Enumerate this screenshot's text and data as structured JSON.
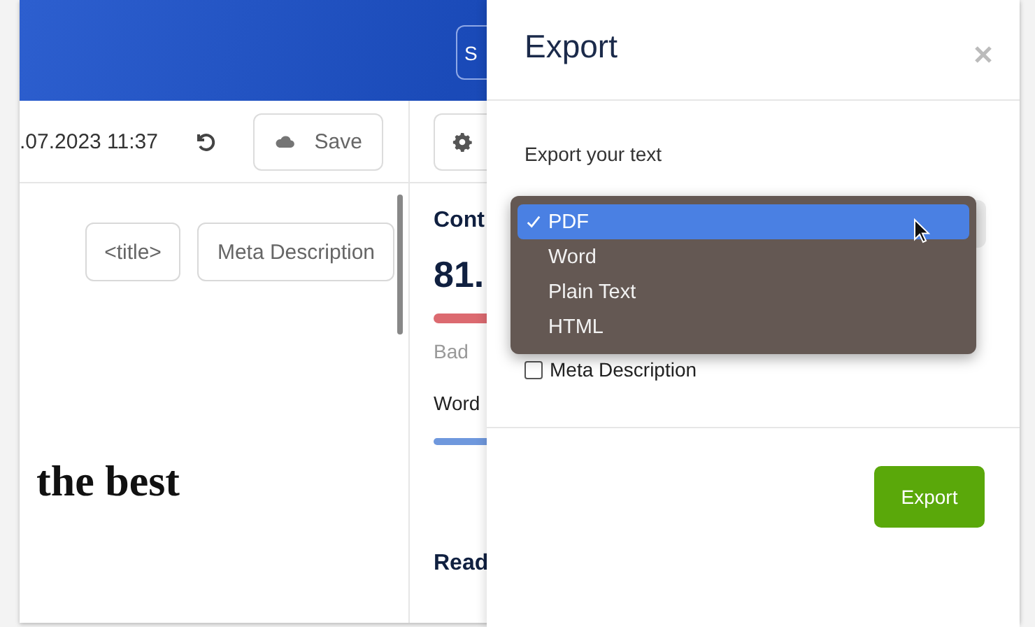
{
  "header": {
    "button_label": "S"
  },
  "toolbar": {
    "timestamp": ".07.2023 11:37",
    "save_label": "Save"
  },
  "editor": {
    "tag_buttons": [
      "<title>",
      "Meta Description"
    ],
    "heading": "the best"
  },
  "score_panel": {
    "title": "Cont",
    "score": "81.",
    "rating": "Bad",
    "words_label": "Word",
    "section": "Read"
  },
  "export_dialog": {
    "title": "Export",
    "prompt": "Export your text",
    "format_options": [
      {
        "label": "PDF",
        "selected": true
      },
      {
        "label": "Word",
        "selected": false
      },
      {
        "label": "Plain Text",
        "selected": false
      },
      {
        "label": "HTML",
        "selected": false
      }
    ],
    "checkboxes": [
      {
        "label": "Meta Description",
        "checked": false
      }
    ],
    "export_button": "Export"
  }
}
